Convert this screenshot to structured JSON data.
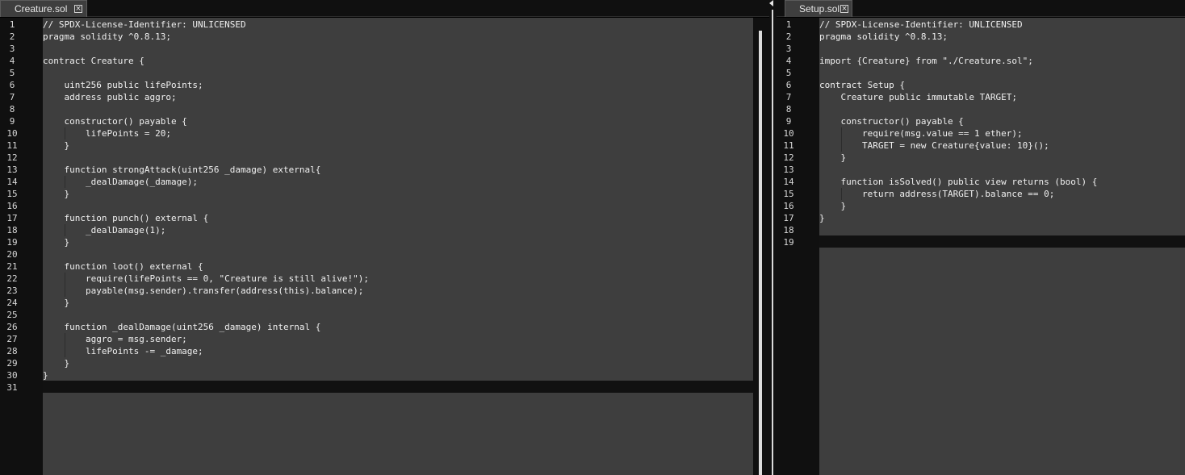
{
  "colors": {
    "editor_bg": "#3e3e3e",
    "gutter_bg": "#101010",
    "current_line": "#111111",
    "text": "#f0f0f0"
  },
  "left_pane": {
    "tab": {
      "label": "Creature.sol",
      "close_icon": "close-icon"
    },
    "lines": [
      "// SPDX-License-Identifier: UNLICENSED",
      "pragma solidity ^0.8.13;",
      "",
      "contract Creature {",
      "",
      "    uint256 public lifePoints;",
      "    address public aggro;",
      "",
      "    constructor() payable {",
      "        lifePoints = 20;",
      "    }",
      "",
      "    function strongAttack(uint256 _damage) external{",
      "        _dealDamage(_damage);",
      "    }",
      "",
      "    function punch() external {",
      "        _dealDamage(1);",
      "    }",
      "",
      "    function loot() external {",
      "        require(lifePoints == 0, \"Creature is still alive!\");",
      "        payable(msg.sender).transfer(address(this).balance);",
      "    }",
      "",
      "    function _dealDamage(uint256 _damage) internal {",
      "        aggro = msg.sender;",
      "        lifePoints -= _damage;",
      "    }",
      "}",
      ""
    ]
  },
  "right_pane": {
    "tab": {
      "label": "Setup.sol",
      "close_icon": "close-icon"
    },
    "lines": [
      "// SPDX-License-Identifier: UNLICENSED",
      "pragma solidity ^0.8.13;",
      "",
      "import {Creature} from \"./Creature.sol\";",
      "",
      "contract Setup {",
      "    Creature public immutable TARGET;",
      "",
      "    constructor() payable {",
      "        require(msg.value == 1 ether);",
      "        TARGET = new Creature{value: 10}();",
      "    }",
      "",
      "    function isSolved() public view returns (bool) {",
      "        return address(TARGET).balance == 0;",
      "    }",
      "}",
      "",
      ""
    ]
  }
}
